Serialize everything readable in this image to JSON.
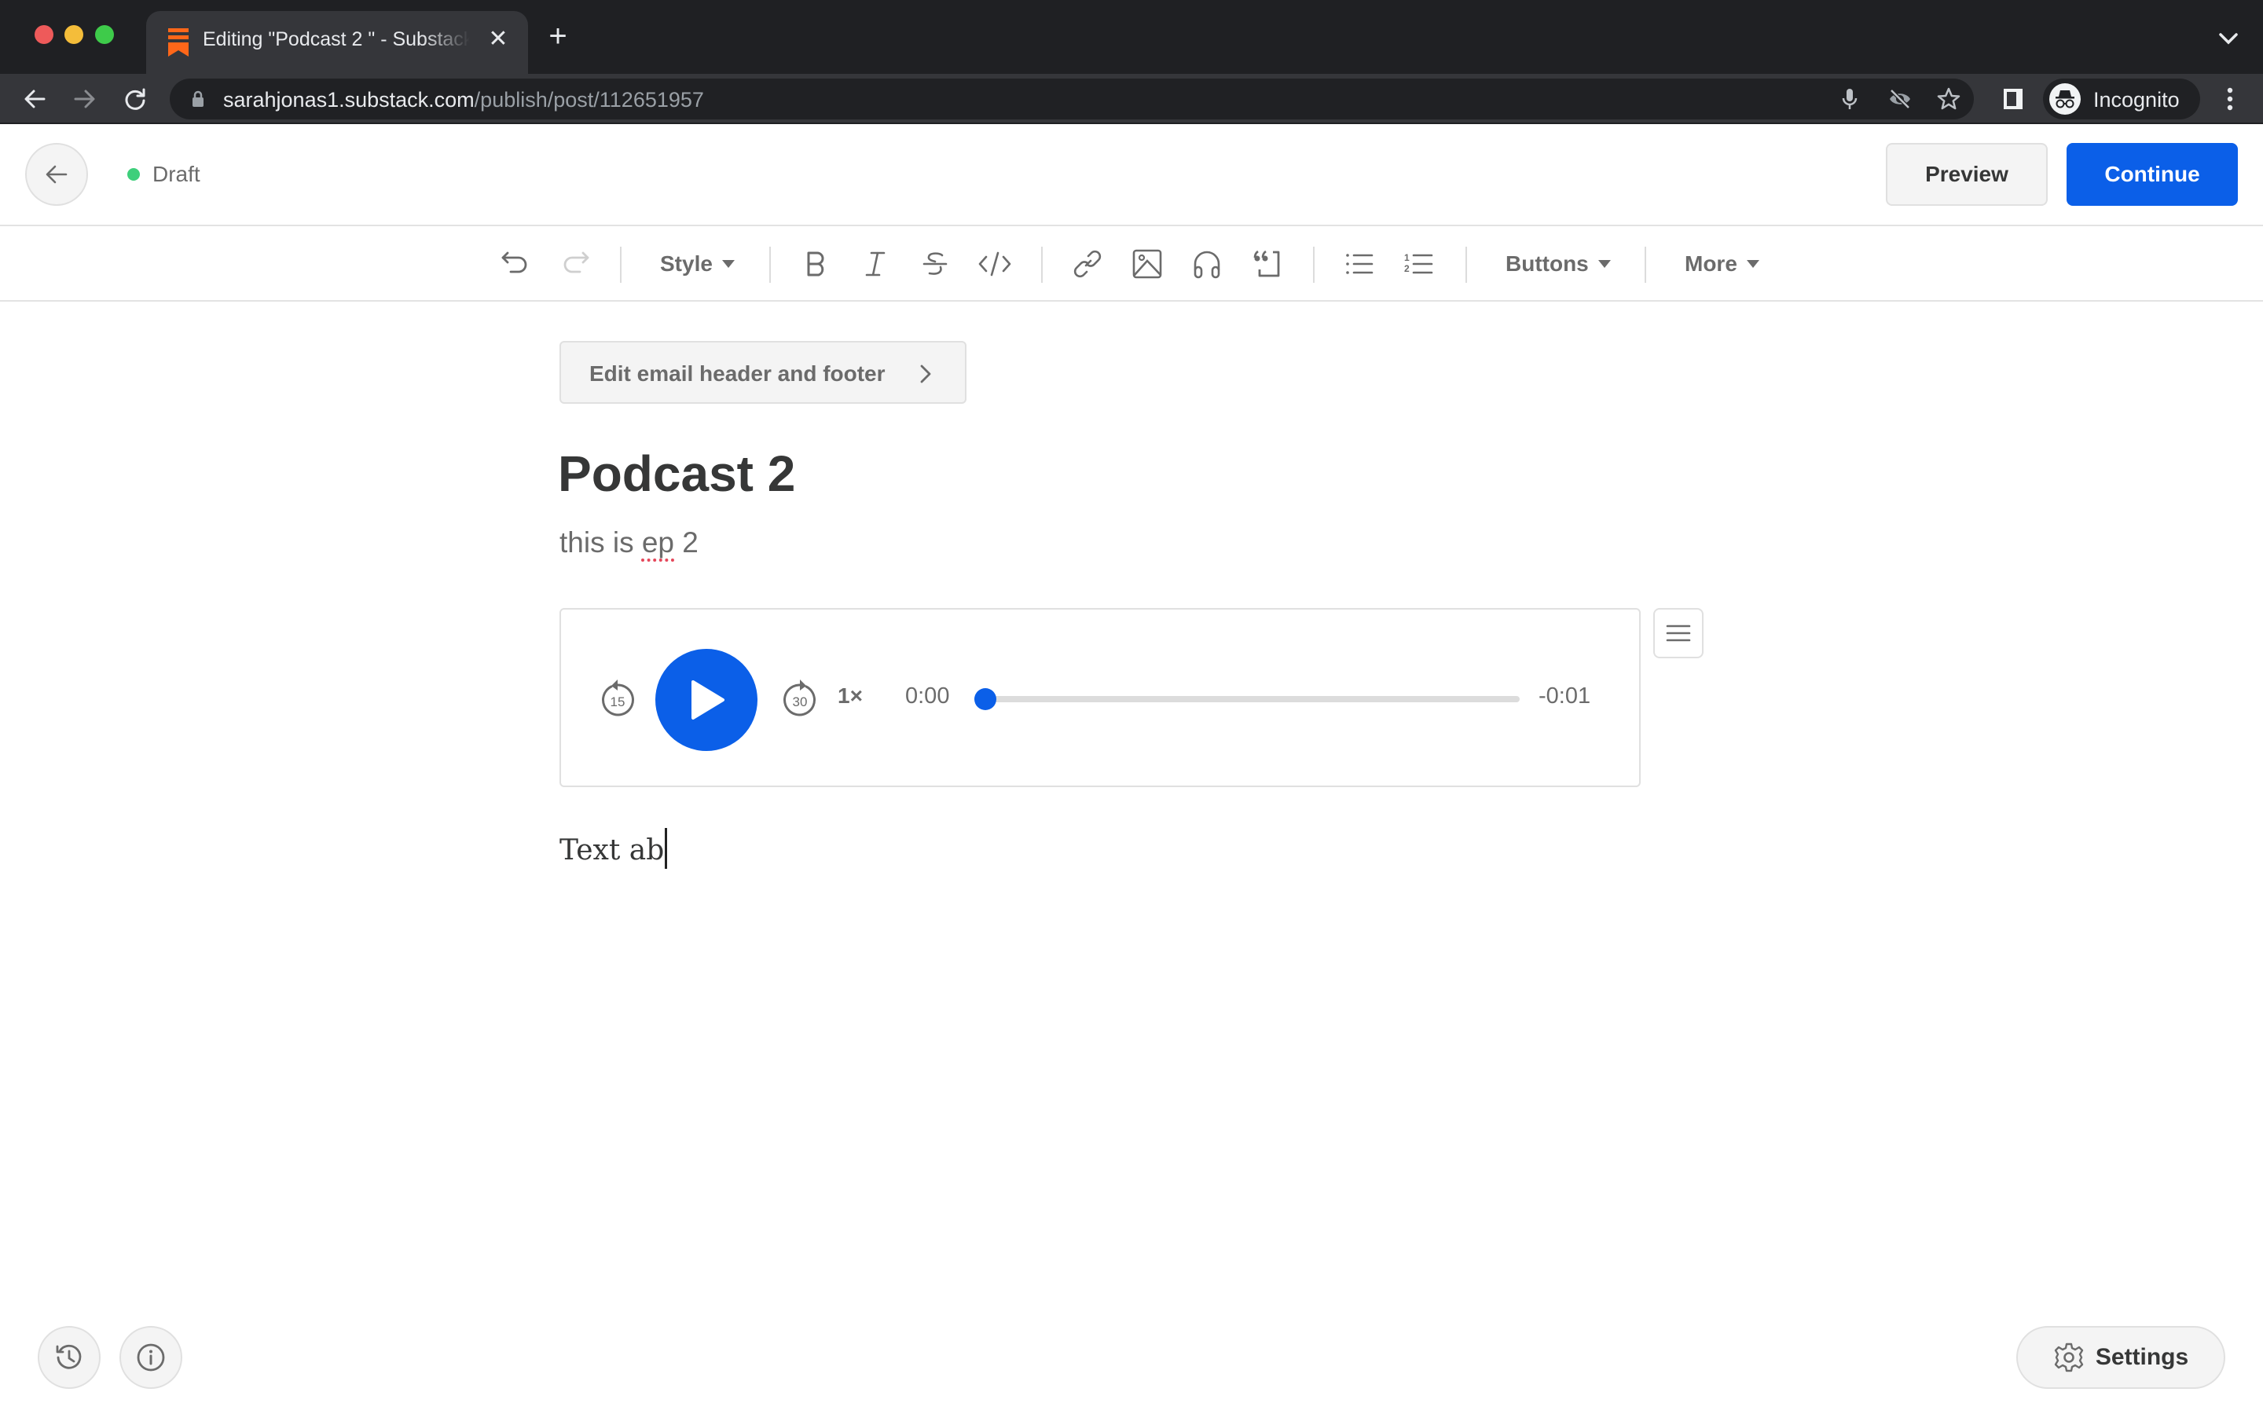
{
  "browser": {
    "tab_title": "Editing \"Podcast 2 \" - Substack",
    "close_tab_glyph": "✕",
    "new_tab_glyph": "+",
    "url_host": "sarahjonas1.substack.com",
    "url_path": "/publish/post/112651957",
    "profile_label": "Incognito",
    "icons": [
      "back-icon",
      "forward-icon",
      "reload-icon",
      "lock-icon",
      "microphone-icon",
      "eye-off-icon",
      "star-icon",
      "side-panel-icon",
      "incognito-icon",
      "kebab-menu-icon",
      "tab-search-chevron-icon"
    ]
  },
  "header": {
    "status": "Draft",
    "status_color": "#3ecf7b",
    "preview_label": "Preview",
    "continue_label": "Continue",
    "accent_color": "#0b5fe8"
  },
  "toolbar": {
    "style_label": "Style",
    "buttons_label": "Buttons",
    "more_label": "More",
    "icons": [
      "undo-icon",
      "redo-icon",
      "bold-icon",
      "italic-icon",
      "strikethrough-icon",
      "code-icon",
      "link-icon",
      "image-icon",
      "audio-icon",
      "quote-icon",
      "bullet-list-icon",
      "numbered-list-icon"
    ]
  },
  "content": {
    "email_header_footer_label": "Edit email header and footer",
    "title": "Podcast 2",
    "subtitle_before": "this is ",
    "subtitle_misspelled": "ep",
    "subtitle_after": " 2",
    "body_text": "Text ab"
  },
  "audio_player": {
    "skip_back_seconds": "15",
    "skip_forward_seconds": "30",
    "speed": "1×",
    "current_time": "0:00",
    "remaining_time": "-0:01",
    "progress_fraction": 0
  },
  "footer": {
    "settings_label": "Settings"
  }
}
